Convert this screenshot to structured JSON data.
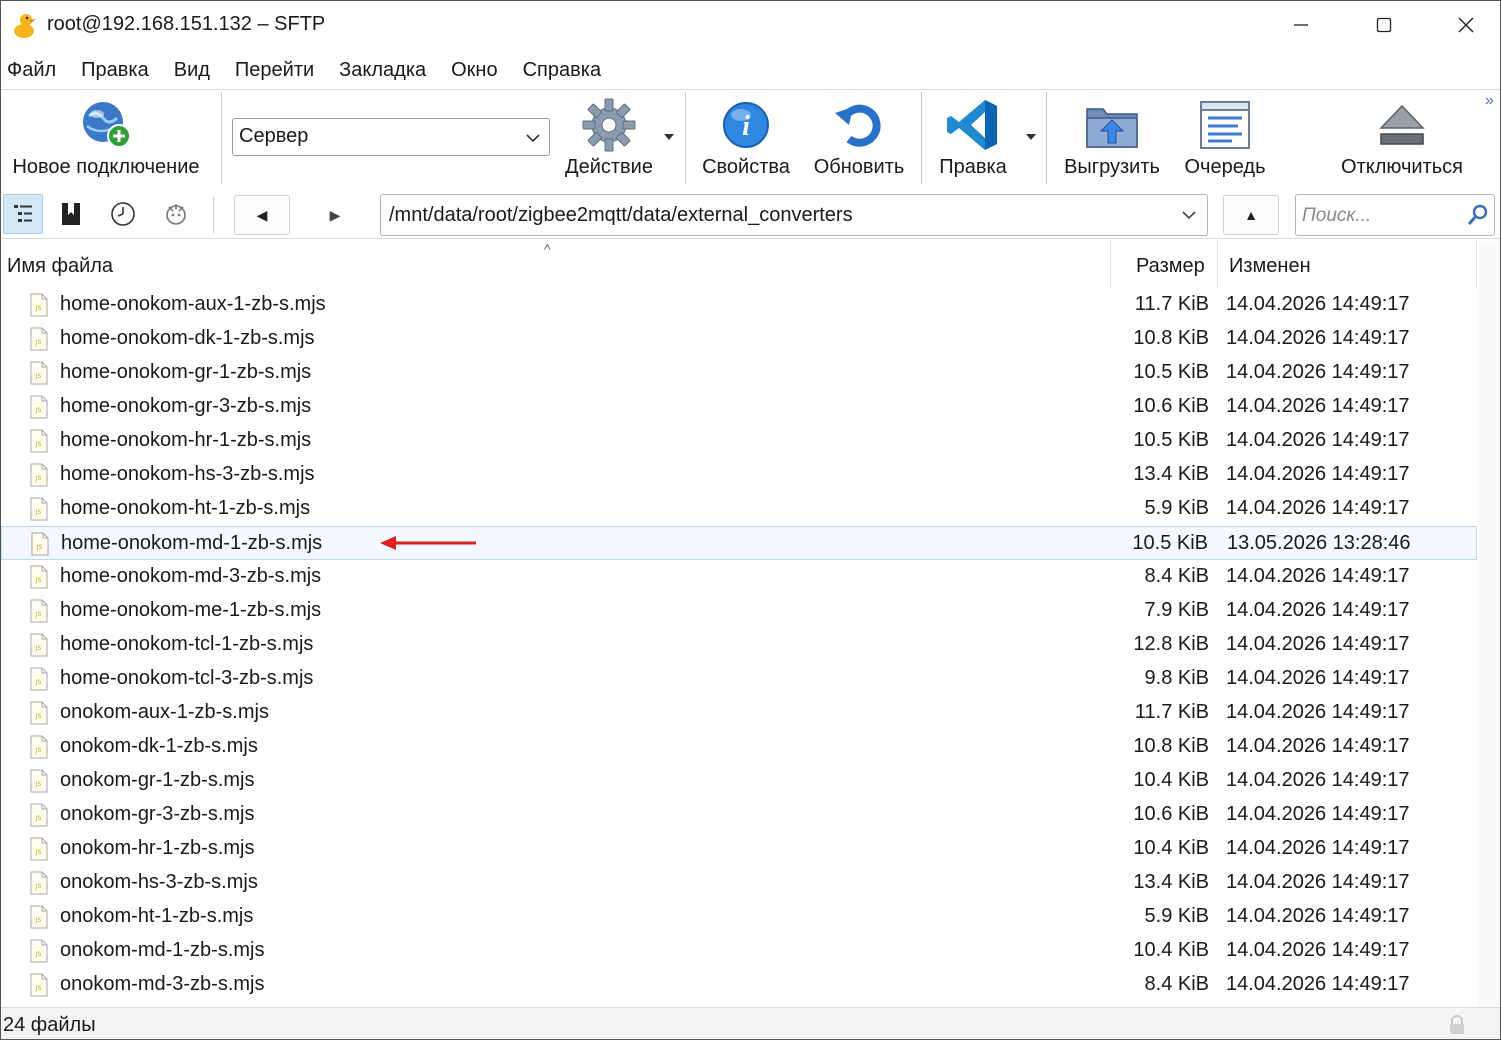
{
  "window": {
    "title": "root@192.168.151.132 – SFTP",
    "min_glyph": "—",
    "max_glyph": "☐",
    "close_glyph": "✕"
  },
  "menu": [
    "Файл",
    "Правка",
    "Вид",
    "Перейти",
    "Закладка",
    "Окно",
    "Справка"
  ],
  "toolbar": {
    "new_connection": "Новое подключение",
    "server_value": "Сервер",
    "action": "Действие",
    "properties": "Свойства",
    "refresh": "Обновить",
    "edit": "Правка",
    "upload": "Выгрузить",
    "queue": "Очередь",
    "disconnect": "Отключиться",
    "overflow": "»"
  },
  "pathbar": {
    "path": "/mnt/data/root/zigbee2mqtt/data/external_converters",
    "search_placeholder": "Поиск...",
    "back_glyph": "◀",
    "forward_glyph": "▶",
    "up_glyph": "▲"
  },
  "columns": {
    "name": "Имя файла",
    "size": "Размер",
    "modified": "Изменен",
    "sort_glyph": "^"
  },
  "files": [
    {
      "name": "home-onokom-aux-1-zb-s.mjs",
      "size": "11.7 KiB",
      "modified": "14.04.2026 14:49:17"
    },
    {
      "name": "home-onokom-dk-1-zb-s.mjs",
      "size": "10.8 KiB",
      "modified": "14.04.2026 14:49:17"
    },
    {
      "name": "home-onokom-gr-1-zb-s.mjs",
      "size": "10.5 KiB",
      "modified": "14.04.2026 14:49:17"
    },
    {
      "name": "home-onokom-gr-3-zb-s.mjs",
      "size": "10.6 KiB",
      "modified": "14.04.2026 14:49:17"
    },
    {
      "name": "home-onokom-hr-1-zb-s.mjs",
      "size": "10.5 KiB",
      "modified": "14.04.2026 14:49:17"
    },
    {
      "name": "home-onokom-hs-3-zb-s.mjs",
      "size": "13.4 KiB",
      "modified": "14.04.2026 14:49:17"
    },
    {
      "name": "home-onokom-ht-1-zb-s.mjs",
      "size": "5.9 KiB",
      "modified": "14.04.2026 14:49:17"
    },
    {
      "name": "home-onokom-md-1-zb-s.mjs",
      "size": "10.5 KiB",
      "modified": "13.05.2026 13:28:46",
      "selected": true
    },
    {
      "name": "home-onokom-md-3-zb-s.mjs",
      "size": "8.4 KiB",
      "modified": "14.04.2026 14:49:17"
    },
    {
      "name": "home-onokom-me-1-zb-s.mjs",
      "size": "7.9 KiB",
      "modified": "14.04.2026 14:49:17"
    },
    {
      "name": "home-onokom-tcl-1-zb-s.mjs",
      "size": "12.8 KiB",
      "modified": "14.04.2026 14:49:17"
    },
    {
      "name": "home-onokom-tcl-3-zb-s.mjs",
      "size": "9.8 KiB",
      "modified": "14.04.2026 14:49:17"
    },
    {
      "name": "onokom-aux-1-zb-s.mjs",
      "size": "11.7 KiB",
      "modified": "14.04.2026 14:49:17"
    },
    {
      "name": "onokom-dk-1-zb-s.mjs",
      "size": "10.8 KiB",
      "modified": "14.04.2026 14:49:17"
    },
    {
      "name": "onokom-gr-1-zb-s.mjs",
      "size": "10.4 KiB",
      "modified": "14.04.2026 14:49:17"
    },
    {
      "name": "onokom-gr-3-zb-s.mjs",
      "size": "10.6 KiB",
      "modified": "14.04.2026 14:49:17"
    },
    {
      "name": "onokom-hr-1-zb-s.mjs",
      "size": "10.4 KiB",
      "modified": "14.04.2026 14:49:17"
    },
    {
      "name": "onokom-hs-3-zb-s.mjs",
      "size": "13.4 KiB",
      "modified": "14.04.2026 14:49:17"
    },
    {
      "name": "onokom-ht-1-zb-s.mjs",
      "size": "5.9 KiB",
      "modified": "14.04.2026 14:49:17"
    },
    {
      "name": "onokom-md-1-zb-s.mjs",
      "size": "10.4 KiB",
      "modified": "14.04.2026 14:49:17"
    },
    {
      "name": "onokom-md-3-zb-s.mjs",
      "size": "8.4 KiB",
      "modified": "14.04.2026 14:49:17"
    }
  ],
  "status": {
    "count_text": "24 файлы"
  },
  "colors": {
    "selected_row_bg": "#f3f9fe",
    "selected_row_border": "#b9dcf6",
    "annotation_arrow": "#e02020",
    "vscode_blue": "#1f8ad2"
  },
  "icons": {
    "file": "js-file-icon",
    "annotation": "red-arrow-icon"
  }
}
